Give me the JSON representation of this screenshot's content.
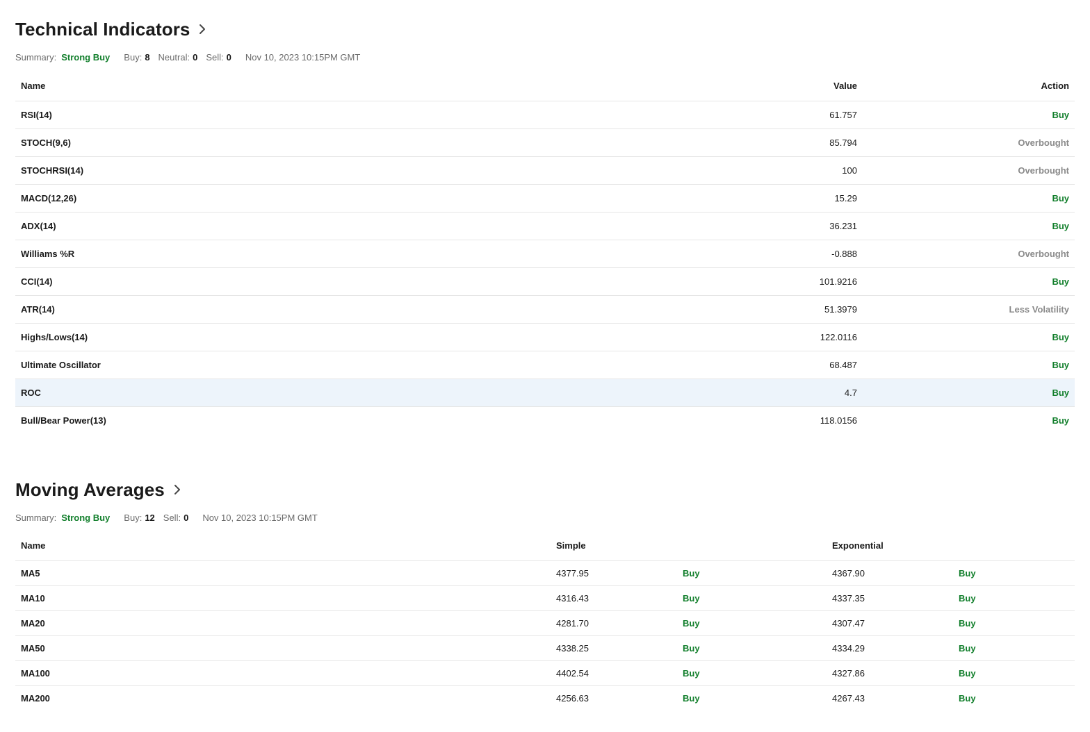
{
  "colors": {
    "buy": "#127f2c",
    "neutral": "#8a8a8a",
    "text": "#1a1a1a",
    "muted": "#6b6b6b",
    "highlight_row": "#edf4fb",
    "divider": "#e6e6e6"
  },
  "technical_indicators": {
    "title": "Technical Indicators",
    "summary_label": "Summary:",
    "summary_value": "Strong Buy",
    "buy_label": "Buy:",
    "buy_count": "8",
    "neutral_label": "Neutral:",
    "neutral_count": "0",
    "sell_label": "Sell:",
    "sell_count": "0",
    "timestamp": "Nov 10, 2023 10:15PM GMT",
    "headers": {
      "name": "Name",
      "value": "Value",
      "action": "Action"
    },
    "rows": [
      {
        "name": "RSI(14)",
        "value": "61.757",
        "action": "Buy",
        "type": "buy"
      },
      {
        "name": "STOCH(9,6)",
        "value": "85.794",
        "action": "Overbought",
        "type": "over"
      },
      {
        "name": "STOCHRSI(14)",
        "value": "100",
        "action": "Overbought",
        "type": "over"
      },
      {
        "name": "MACD(12,26)",
        "value": "15.29",
        "action": "Buy",
        "type": "buy"
      },
      {
        "name": "ADX(14)",
        "value": "36.231",
        "action": "Buy",
        "type": "buy"
      },
      {
        "name": "Williams %R",
        "value": "-0.888",
        "action": "Overbought",
        "type": "over"
      },
      {
        "name": "CCI(14)",
        "value": "101.9216",
        "action": "Buy",
        "type": "buy"
      },
      {
        "name": "ATR(14)",
        "value": "51.3979",
        "action": "Less Volatility",
        "type": "neutral"
      },
      {
        "name": "Highs/Lows(14)",
        "value": "122.0116",
        "action": "Buy",
        "type": "buy"
      },
      {
        "name": "Ultimate Oscillator",
        "value": "68.487",
        "action": "Buy",
        "type": "buy"
      },
      {
        "name": "ROC",
        "value": "4.7",
        "action": "Buy",
        "type": "buy",
        "highlighted": true
      },
      {
        "name": "Bull/Bear Power(13)",
        "value": "118.0156",
        "action": "Buy",
        "type": "buy"
      }
    ]
  },
  "moving_averages": {
    "title": "Moving Averages",
    "summary_label": "Summary:",
    "summary_value": "Strong Buy",
    "buy_label": "Buy:",
    "buy_count": "12",
    "sell_label": "Sell:",
    "sell_count": "0",
    "timestamp": "Nov 10, 2023 10:15PM GMT",
    "headers": {
      "name": "Name",
      "simple": "Simple",
      "exponential": "Exponential"
    },
    "rows": [
      {
        "name": "MA5",
        "simple": "4377.95",
        "simple_action": "Buy",
        "exp": "4367.90",
        "exp_action": "Buy"
      },
      {
        "name": "MA10",
        "simple": "4316.43",
        "simple_action": "Buy",
        "exp": "4337.35",
        "exp_action": "Buy"
      },
      {
        "name": "MA20",
        "simple": "4281.70",
        "simple_action": "Buy",
        "exp": "4307.47",
        "exp_action": "Buy"
      },
      {
        "name": "MA50",
        "simple": "4338.25",
        "simple_action": "Buy",
        "exp": "4334.29",
        "exp_action": "Buy"
      },
      {
        "name": "MA100",
        "simple": "4402.54",
        "simple_action": "Buy",
        "exp": "4327.86",
        "exp_action": "Buy"
      },
      {
        "name": "MA200",
        "simple": "4256.63",
        "simple_action": "Buy",
        "exp": "4267.43",
        "exp_action": "Buy"
      }
    ]
  }
}
